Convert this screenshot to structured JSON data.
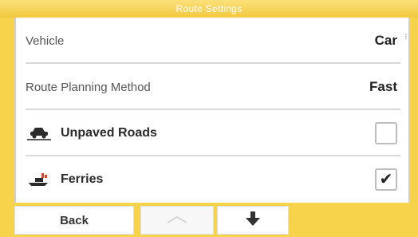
{
  "window": {
    "title": "Route Settings"
  },
  "settings": [
    {
      "label": "Vehicle",
      "value": "Car"
    },
    {
      "label": "Route Planning Method",
      "value": "Fast"
    }
  ],
  "options": [
    {
      "label": "Unpaved Roads",
      "icon": "unpaved-road-icon",
      "checked": false
    },
    {
      "label": "Ferries",
      "icon": "ferry-icon",
      "checked": true
    }
  ],
  "bottom": {
    "back_label": "Back",
    "up_icon": "scroll-up-icon",
    "down_icon": "scroll-down-icon"
  },
  "colors": {
    "frame": "#f6d34a",
    "panel": "#ffffff",
    "divider": "#d8d8d8"
  }
}
